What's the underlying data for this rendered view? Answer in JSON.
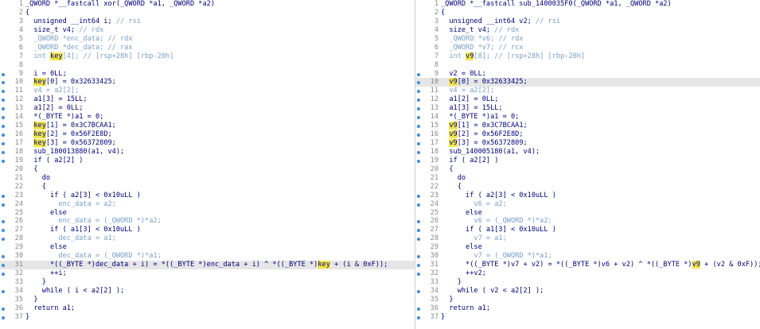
{
  "left": {
    "lines": [
      {
        "n": "1",
        "dot": false,
        "hl": false,
        "t": [
          {
            "s": "_QWORD *__fastcall xor(_QWORD *a1, _QWORD *a2)",
            "k": "k"
          }
        ]
      },
      {
        "n": "2",
        "dot": false,
        "hl": false,
        "t": [
          {
            "s": "{",
            "k": "k"
          }
        ]
      },
      {
        "n": "3",
        "dot": false,
        "hl": false,
        "t": [
          {
            "s": "  unsigned __int64 i; ",
            "k": "k"
          },
          {
            "s": "// rsi",
            "k": "c"
          }
        ]
      },
      {
        "n": "4",
        "dot": false,
        "hl": false,
        "t": [
          {
            "s": "  size_t v4; ",
            "k": "k"
          },
          {
            "s": "// rdx",
            "k": "c"
          }
        ]
      },
      {
        "n": "5",
        "dot": false,
        "hl": false,
        "t": [
          {
            "s": "  _QWORD *enc_data; ",
            "k": "c"
          },
          {
            "s": "// rdx",
            "k": "c"
          }
        ]
      },
      {
        "n": "6",
        "dot": false,
        "hl": false,
        "t": [
          {
            "s": "  _QWORD *dec_data; ",
            "k": "c"
          },
          {
            "s": "// rax",
            "k": "c"
          }
        ]
      },
      {
        "n": "7",
        "dot": false,
        "hl": false,
        "t": [
          {
            "s": "  int ",
            "k": "c"
          },
          {
            "s": "key",
            "k": "kh"
          },
          {
            "s": "[4]; ",
            "k": "c"
          },
          {
            "s": "// [rsp+28h] [rbp-20h]",
            "k": "c"
          }
        ]
      },
      {
        "n": "8",
        "dot": false,
        "hl": false,
        "t": [
          {
            "s": "",
            "k": "k"
          }
        ]
      },
      {
        "n": "9",
        "dot": true,
        "hl": false,
        "t": [
          {
            "s": "  i = 0LL;",
            "k": "k"
          }
        ]
      },
      {
        "n": "10",
        "dot": true,
        "hl": false,
        "t": [
          {
            "s": "  ",
            "k": "k"
          },
          {
            "s": "key",
            "k": "kh"
          },
          {
            "s": "[0] = 0x32633425;",
            "k": "k"
          }
        ]
      },
      {
        "n": "11",
        "dot": true,
        "hl": false,
        "t": [
          {
            "s": "  v4 = a2[2];",
            "k": "c"
          }
        ]
      },
      {
        "n": "12",
        "dot": true,
        "hl": false,
        "t": [
          {
            "s": "  a1[3] = 15LL;",
            "k": "k"
          }
        ]
      },
      {
        "n": "13",
        "dot": true,
        "hl": false,
        "t": [
          {
            "s": "  a1[2] = 0LL;",
            "k": "k"
          }
        ]
      },
      {
        "n": "14",
        "dot": true,
        "hl": false,
        "t": [
          {
            "s": "  *(_BYTE *)a1 = 0;",
            "k": "k"
          }
        ]
      },
      {
        "n": "15",
        "dot": true,
        "hl": false,
        "t": [
          {
            "s": "  ",
            "k": "k"
          },
          {
            "s": "key",
            "k": "kh"
          },
          {
            "s": "[1] = 0x3C7BCAA1;",
            "k": "k"
          }
        ]
      },
      {
        "n": "16",
        "dot": true,
        "hl": false,
        "t": [
          {
            "s": "  ",
            "k": "k"
          },
          {
            "s": "key",
            "k": "kh"
          },
          {
            "s": "[2] = 0x56F2E8D;",
            "k": "k"
          }
        ]
      },
      {
        "n": "17",
        "dot": true,
        "hl": false,
        "t": [
          {
            "s": "  ",
            "k": "k"
          },
          {
            "s": "key",
            "k": "kh"
          },
          {
            "s": "[3] = 0x56372809;",
            "k": "k"
          }
        ]
      },
      {
        "n": "18",
        "dot": true,
        "hl": false,
        "t": [
          {
            "s": "  sub_180013880(a1, v4);",
            "k": "k"
          }
        ]
      },
      {
        "n": "19",
        "dot": true,
        "hl": false,
        "t": [
          {
            "s": "  if ( a2[2] )",
            "k": "k"
          }
        ]
      },
      {
        "n": "20",
        "dot": false,
        "hl": false,
        "t": [
          {
            "s": "  {",
            "k": "k"
          }
        ]
      },
      {
        "n": "21",
        "dot": false,
        "hl": false,
        "t": [
          {
            "s": "    do",
            "k": "k"
          }
        ]
      },
      {
        "n": "22",
        "dot": false,
        "hl": false,
        "t": [
          {
            "s": "    {",
            "k": "k"
          }
        ]
      },
      {
        "n": "23",
        "dot": true,
        "hl": false,
        "t": [
          {
            "s": "      if ( a2[3] < 0x10uLL )",
            "k": "k"
          }
        ]
      },
      {
        "n": "24",
        "dot": true,
        "hl": false,
        "t": [
          {
            "s": "        enc_data = a2;",
            "k": "c"
          }
        ]
      },
      {
        "n": "25",
        "dot": false,
        "hl": false,
        "t": [
          {
            "s": "      else",
            "k": "k"
          }
        ]
      },
      {
        "n": "26",
        "dot": true,
        "hl": false,
        "t": [
          {
            "s": "        enc_data = (_QWORD *)*a2;",
            "k": "c"
          }
        ]
      },
      {
        "n": "27",
        "dot": true,
        "hl": false,
        "t": [
          {
            "s": "      if ( a1[3] < 0x10uLL )",
            "k": "k"
          }
        ]
      },
      {
        "n": "28",
        "dot": true,
        "hl": false,
        "t": [
          {
            "s": "        dec_data = a1;",
            "k": "c"
          }
        ]
      },
      {
        "n": "29",
        "dot": false,
        "hl": false,
        "t": [
          {
            "s": "      else",
            "k": "k"
          }
        ]
      },
      {
        "n": "30",
        "dot": true,
        "hl": false,
        "t": [
          {
            "s": "        dec_data = (_QWORD *)*a1;",
            "k": "c"
          }
        ]
      },
      {
        "n": "31",
        "dot": true,
        "hl": true,
        "t": [
          {
            "s": "      *((_BYTE *)dec_data + i) = *((_BYTE *)enc_data + i) ^ *((_BYTE *)",
            "k": "k"
          },
          {
            "s": "key",
            "k": "kh"
          },
          {
            "s": " + (i & 0xF));",
            "k": "k"
          }
        ]
      },
      {
        "n": "32",
        "dot": true,
        "hl": false,
        "t": [
          {
            "s": "      ++i;",
            "k": "k"
          }
        ]
      },
      {
        "n": "33",
        "dot": false,
        "hl": false,
        "t": [
          {
            "s": "    }",
            "k": "k"
          }
        ]
      },
      {
        "n": "34",
        "dot": true,
        "hl": false,
        "t": [
          {
            "s": "    while ( i < a2[2] );",
            "k": "k"
          }
        ]
      },
      {
        "n": "35",
        "dot": false,
        "hl": false,
        "t": [
          {
            "s": "  }",
            "k": "k"
          }
        ]
      },
      {
        "n": "36",
        "dot": true,
        "hl": false,
        "t": [
          {
            "s": "  return a1;",
            "k": "k"
          }
        ]
      },
      {
        "n": "37",
        "dot": true,
        "hl": false,
        "t": [
          {
            "s": "}",
            "k": "k"
          }
        ]
      }
    ]
  },
  "right": {
    "lines": [
      {
        "n": "1",
        "dot": false,
        "hl": false,
        "t": [
          {
            "s": "_QWORD *__fastcall sub_1400035F0(_QWORD *a1, _QWORD *a2)",
            "k": "k"
          }
        ]
      },
      {
        "n": "2",
        "dot": false,
        "hl": false,
        "t": [
          {
            "s": "{",
            "k": "k"
          }
        ]
      },
      {
        "n": "3",
        "dot": false,
        "hl": false,
        "t": [
          {
            "s": "  unsigned __int64 v2; ",
            "k": "k"
          },
          {
            "s": "// rsi",
            "k": "c"
          }
        ]
      },
      {
        "n": "4",
        "dot": false,
        "hl": false,
        "t": [
          {
            "s": "  size_t v4; ",
            "k": "k"
          },
          {
            "s": "// rdx",
            "k": "c"
          }
        ]
      },
      {
        "n": "5",
        "dot": false,
        "hl": false,
        "t": [
          {
            "s": "  _QWORD *v6; ",
            "k": "c"
          },
          {
            "s": "// rdx",
            "k": "c"
          }
        ]
      },
      {
        "n": "6",
        "dot": false,
        "hl": false,
        "t": [
          {
            "s": "  _QWORD *v7; ",
            "k": "c"
          },
          {
            "s": "// rcx",
            "k": "c"
          }
        ]
      },
      {
        "n": "7",
        "dot": false,
        "hl": false,
        "t": [
          {
            "s": "  int ",
            "k": "c"
          },
          {
            "s": "v9",
            "k": "kh"
          },
          {
            "s": "[8]; ",
            "k": "c"
          },
          {
            "s": "// [rsp+28h] [rbp-20h]",
            "k": "c"
          }
        ]
      },
      {
        "n": "8",
        "dot": false,
        "hl": false,
        "t": [
          {
            "s": "",
            "k": "k"
          }
        ]
      },
      {
        "n": "9",
        "dot": true,
        "hl": false,
        "t": [
          {
            "s": "  v2 = 0LL;",
            "k": "k"
          }
        ]
      },
      {
        "n": "10",
        "dot": true,
        "hl": true,
        "t": [
          {
            "s": "  ",
            "k": "k"
          },
          {
            "s": "v9",
            "k": "kh"
          },
          {
            "s": "[0] = 0x32633425;",
            "k": "k"
          }
        ]
      },
      {
        "n": "11",
        "dot": true,
        "hl": false,
        "t": [
          {
            "s": "  v4 = a2[2];",
            "k": "c"
          }
        ]
      },
      {
        "n": "12",
        "dot": true,
        "hl": false,
        "t": [
          {
            "s": "  a1[2] = 0LL;",
            "k": "k"
          }
        ]
      },
      {
        "n": "13",
        "dot": true,
        "hl": false,
        "t": [
          {
            "s": "  a1[3] = 15LL;",
            "k": "k"
          }
        ]
      },
      {
        "n": "14",
        "dot": true,
        "hl": false,
        "t": [
          {
            "s": "  *(_BYTE *)a1 = 0;",
            "k": "k"
          }
        ]
      },
      {
        "n": "15",
        "dot": true,
        "hl": false,
        "t": [
          {
            "s": "  ",
            "k": "k"
          },
          {
            "s": "v9",
            "k": "kh"
          },
          {
            "s": "[1] = 0x3C7BCAA1;",
            "k": "k"
          }
        ]
      },
      {
        "n": "16",
        "dot": true,
        "hl": false,
        "t": [
          {
            "s": "  ",
            "k": "k"
          },
          {
            "s": "v9",
            "k": "kh"
          },
          {
            "s": "[2] = 0x56F2E8D;",
            "k": "k"
          }
        ]
      },
      {
        "n": "17",
        "dot": true,
        "hl": false,
        "t": [
          {
            "s": "  ",
            "k": "k"
          },
          {
            "s": "v9",
            "k": "kh"
          },
          {
            "s": "[3] = 0x56372809;",
            "k": "k"
          }
        ]
      },
      {
        "n": "18",
        "dot": true,
        "hl": false,
        "t": [
          {
            "s": "  sub_140005180(a1, v4);",
            "k": "k"
          }
        ]
      },
      {
        "n": "19",
        "dot": true,
        "hl": false,
        "t": [
          {
            "s": "  if ( a2[2] )",
            "k": "k"
          }
        ]
      },
      {
        "n": "20",
        "dot": false,
        "hl": false,
        "t": [
          {
            "s": "  {",
            "k": "k"
          }
        ]
      },
      {
        "n": "21",
        "dot": false,
        "hl": false,
        "t": [
          {
            "s": "    do",
            "k": "k"
          }
        ]
      },
      {
        "n": "22",
        "dot": false,
        "hl": false,
        "t": [
          {
            "s": "    {",
            "k": "k"
          }
        ]
      },
      {
        "n": "23",
        "dot": true,
        "hl": false,
        "t": [
          {
            "s": "      if ( a2[3] < 0x10uLL )",
            "k": "k"
          }
        ]
      },
      {
        "n": "24",
        "dot": true,
        "hl": false,
        "t": [
          {
            "s": "        v6 = a2;",
            "k": "c"
          }
        ]
      },
      {
        "n": "25",
        "dot": false,
        "hl": false,
        "t": [
          {
            "s": "      else",
            "k": "k"
          }
        ]
      },
      {
        "n": "26",
        "dot": true,
        "hl": false,
        "t": [
          {
            "s": "        v6 = (_QWORD *)*a2;",
            "k": "c"
          }
        ]
      },
      {
        "n": "27",
        "dot": true,
        "hl": false,
        "t": [
          {
            "s": "      if ( a1[3] < 0x10uLL )",
            "k": "k"
          }
        ]
      },
      {
        "n": "28",
        "dot": true,
        "hl": false,
        "t": [
          {
            "s": "        v7 = a1;",
            "k": "c"
          }
        ]
      },
      {
        "n": "29",
        "dot": false,
        "hl": false,
        "t": [
          {
            "s": "      else",
            "k": "k"
          }
        ]
      },
      {
        "n": "30",
        "dot": true,
        "hl": false,
        "t": [
          {
            "s": "        v7 = (_QWORD *)*a1;",
            "k": "c"
          }
        ]
      },
      {
        "n": "31",
        "dot": true,
        "hl": false,
        "t": [
          {
            "s": "      *((_BYTE *)v7 + v2) = *((_BYTE *)v6 + v2) ^ *((_BYTE *)",
            "k": "k"
          },
          {
            "s": "v9",
            "k": "kh"
          },
          {
            "s": " + (v2 & 0xF));",
            "k": "k"
          }
        ]
      },
      {
        "n": "32",
        "dot": true,
        "hl": false,
        "t": [
          {
            "s": "      ++v2;",
            "k": "k"
          }
        ]
      },
      {
        "n": "33",
        "dot": false,
        "hl": false,
        "t": [
          {
            "s": "    }",
            "k": "k"
          }
        ]
      },
      {
        "n": "34",
        "dot": true,
        "hl": false,
        "t": [
          {
            "s": "    while ( v2 < a2[2] );",
            "k": "k"
          }
        ]
      },
      {
        "n": "35",
        "dot": false,
        "hl": false,
        "t": [
          {
            "s": "  }",
            "k": "k"
          }
        ]
      },
      {
        "n": "36",
        "dot": true,
        "hl": false,
        "t": [
          {
            "s": "  return a1;",
            "k": "k"
          }
        ]
      },
      {
        "n": "37",
        "dot": true,
        "hl": false,
        "t": [
          {
            "s": "}",
            "k": "k"
          }
        ]
      }
    ]
  },
  "colors": {
    "code_text": "#000080",
    "comment": "#7a9fc7",
    "line_number": "#8a8a8a",
    "highlight_word": "#f2e64a",
    "current_line": "#e6e6e6",
    "breakpoint_dot": "#3f8ddc"
  }
}
